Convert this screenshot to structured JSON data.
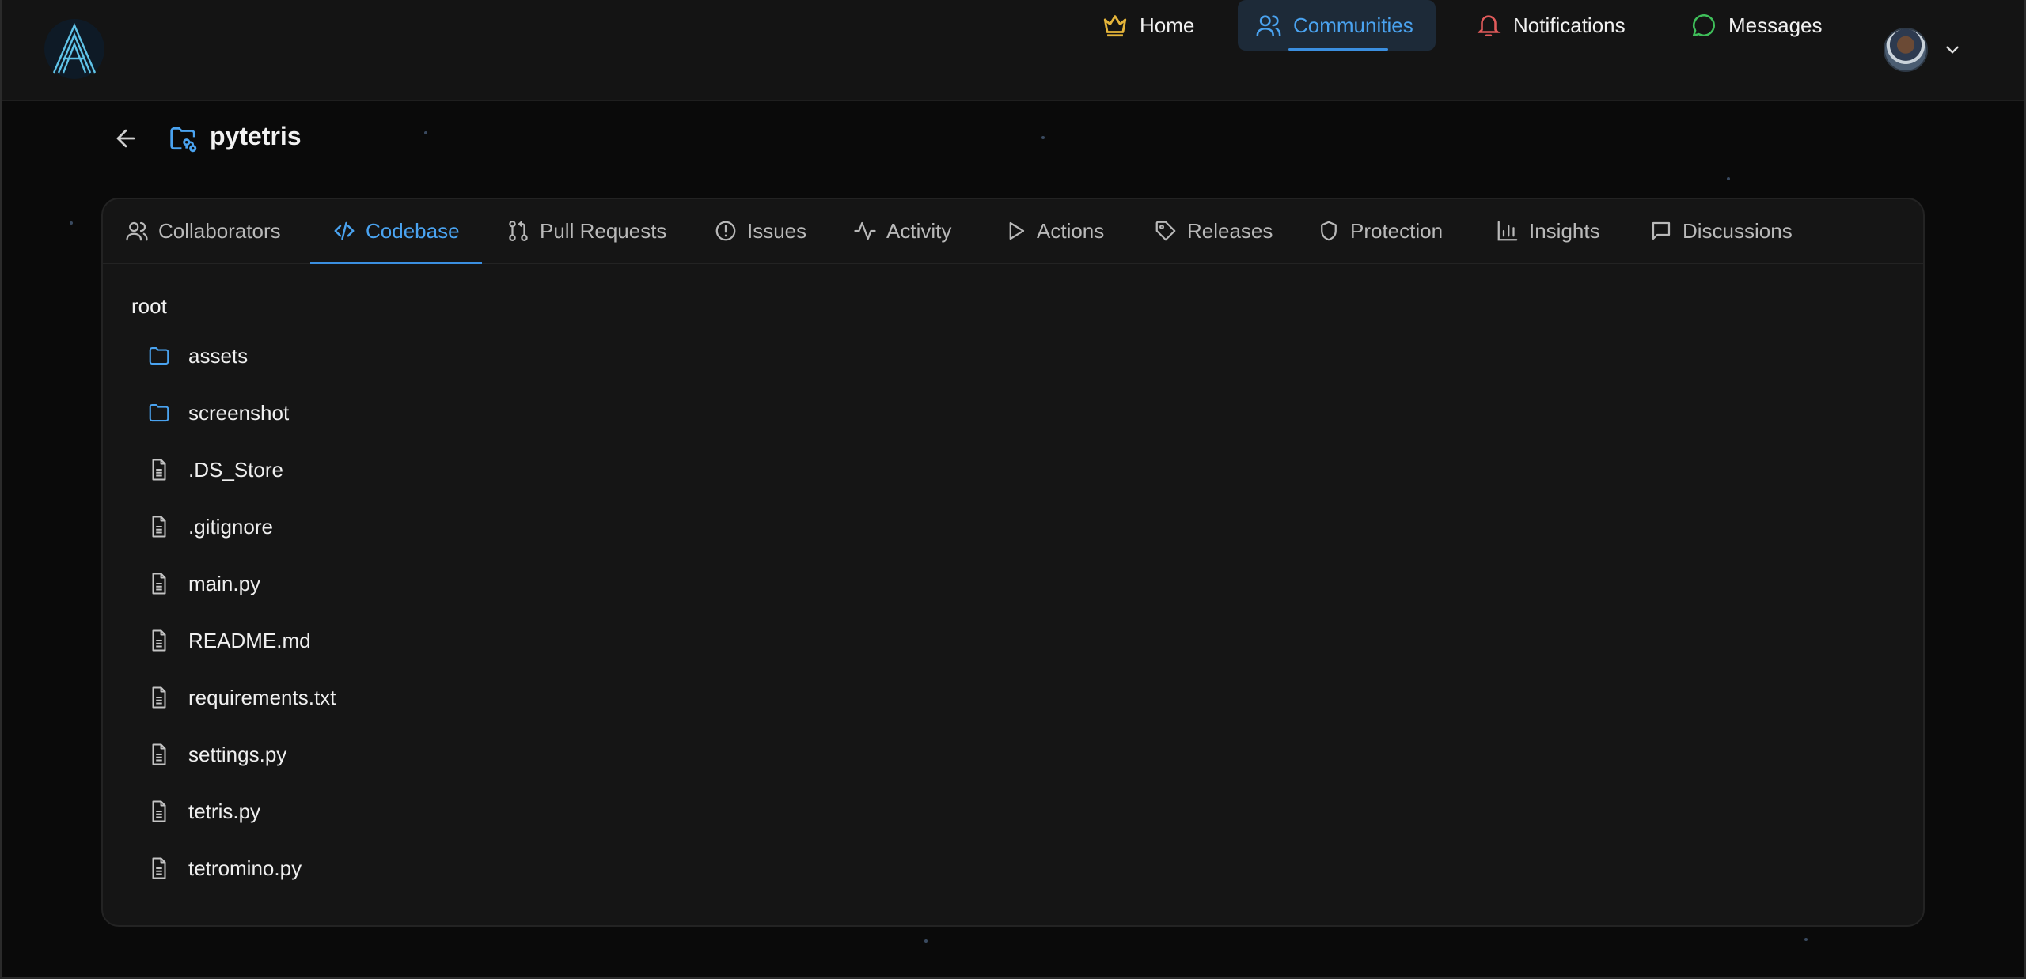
{
  "nav": {
    "home": "Home",
    "communities": "Communities",
    "notifications": "Notifications",
    "messages": "Messages"
  },
  "repo": {
    "name": "pytetris"
  },
  "tabs": [
    {
      "label": "Collaborators",
      "icon": "users-icon"
    },
    {
      "label": "Codebase",
      "icon": "code-icon",
      "active": true
    },
    {
      "label": "Pull Requests",
      "icon": "git-pull-request-icon"
    },
    {
      "label": "Issues",
      "icon": "alert-circle-icon"
    },
    {
      "label": "Activity",
      "icon": "activity-icon"
    },
    {
      "label": "Actions",
      "icon": "play-icon"
    },
    {
      "label": "Releases",
      "icon": "tag-icon"
    },
    {
      "label": "Protection",
      "icon": "shield-icon"
    },
    {
      "label": "Insights",
      "icon": "bar-chart-icon"
    },
    {
      "label": "Discussions",
      "icon": "message-square-icon"
    }
  ],
  "tree": {
    "root_label": "root",
    "items": [
      {
        "name": "assets",
        "type": "folder"
      },
      {
        "name": "screenshot",
        "type": "folder"
      },
      {
        "name": ".DS_Store",
        "type": "file"
      },
      {
        "name": ".gitignore",
        "type": "file"
      },
      {
        "name": "main.py",
        "type": "file"
      },
      {
        "name": "README.md",
        "type": "file"
      },
      {
        "name": "requirements.txt",
        "type": "file"
      },
      {
        "name": "settings.py",
        "type": "file"
      },
      {
        "name": "tetris.py",
        "type": "file"
      },
      {
        "name": "tetromino.py",
        "type": "file"
      }
    ]
  },
  "colors": {
    "accent": "#4aa3f0",
    "crown": "#e5b53a",
    "bell": "#e25b5b",
    "message": "#3fbf5a"
  }
}
